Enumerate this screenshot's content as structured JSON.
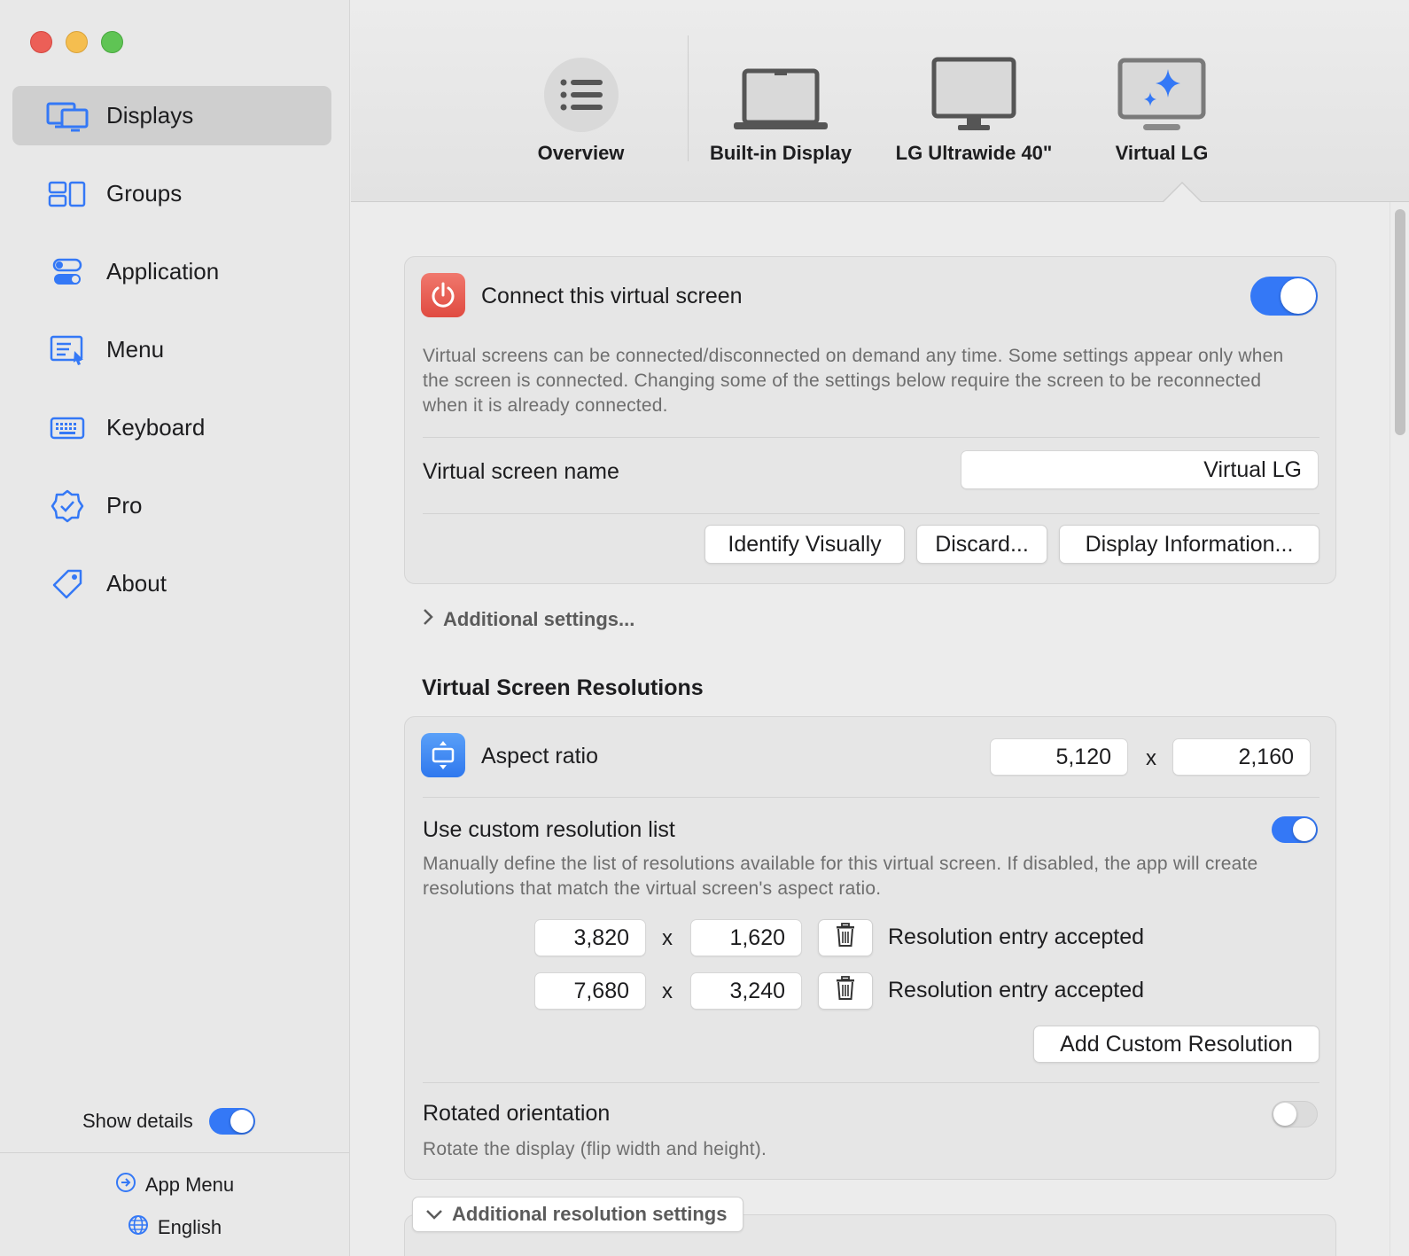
{
  "sidebar": {
    "items": [
      {
        "label": "Displays",
        "icon": "displays-icon",
        "active": true
      },
      {
        "label": "Groups",
        "icon": "groups-icon"
      },
      {
        "label": "Application",
        "icon": "toggles-icon"
      },
      {
        "label": "Menu",
        "icon": "menu-icon"
      },
      {
        "label": "Keyboard",
        "icon": "keyboard-icon"
      },
      {
        "label": "Pro",
        "icon": "checkmark-seal-icon"
      },
      {
        "label": "About",
        "icon": "tag-icon"
      }
    ],
    "show_details_label": "Show details",
    "show_details_on": true,
    "app_menu_label": "App Menu",
    "language_label": "English"
  },
  "tabs": [
    {
      "label": "Overview",
      "icon": "list-icon"
    },
    {
      "label": "Built-in Display",
      "icon": "laptop-icon"
    },
    {
      "label": "LG Ultrawide 40\"",
      "icon": "monitor-icon"
    },
    {
      "label": "Virtual LG",
      "icon": "virtual-monitor-icon",
      "selected": true
    }
  ],
  "connect": {
    "title": "Connect this virtual screen",
    "enabled": true,
    "description": "Virtual screens can be connected/disconnected on demand any time. Some settings appear only when the screen is connected. Changing some of the settings below require the screen to be reconnected when it is already connected.",
    "name_label": "Virtual screen name",
    "name_value": "Virtual LG",
    "buttons": {
      "identify": "Identify Visually",
      "discard": "Discard...",
      "info": "Display Information..."
    }
  },
  "additional_settings_label": "Additional settings...",
  "resolutions": {
    "section_title": "Virtual Screen Resolutions",
    "aspect_label": "Aspect ratio",
    "aspect_width": "5,120",
    "aspect_height": "2,160",
    "x_label": "x",
    "custom_list_label": "Use custom resolution list",
    "custom_list_enabled": true,
    "custom_list_desc": "Manually define the list of resolutions available for this virtual screen. If disabled, the app will create resolutions that match the virtual screen's aspect ratio.",
    "entries": [
      {
        "width": "3,820",
        "height": "1,620",
        "status": "Resolution entry accepted"
      },
      {
        "width": "7,680",
        "height": "3,240",
        "status": "Resolution entry accepted"
      }
    ],
    "add_button": "Add Custom Resolution",
    "rotated_label": "Rotated orientation",
    "rotated_enabled": false,
    "rotated_desc": "Rotate the display (flip width and height)."
  },
  "additional_resolution_label": "Additional resolution settings",
  "colors": {
    "accent": "#3478f6",
    "power_red": "#e8584d",
    "aspect_blue": "#3e8af6"
  }
}
